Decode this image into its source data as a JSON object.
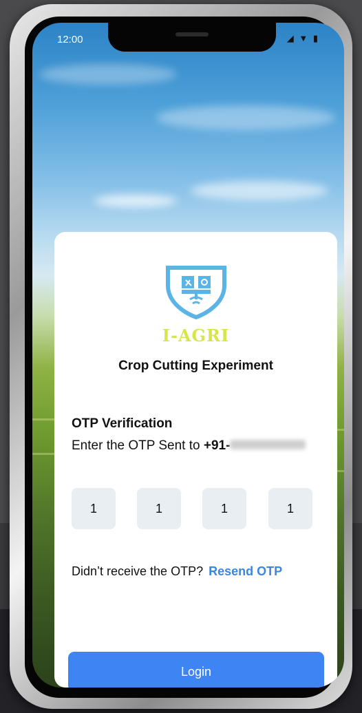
{
  "status_bar": {
    "time": "12:00",
    "icons": "◢ ▼ ▮"
  },
  "logo": {
    "text": "I-AGRI",
    "icon": "shield-logo-icon"
  },
  "app_title": "Crop Cutting Experiment",
  "otp": {
    "heading": "OTP Verification",
    "sent_prefix": "Enter the OTP Sent to ",
    "phone_prefix": "+91-",
    "digits": [
      "1",
      "1",
      "1",
      "1"
    ]
  },
  "resend": {
    "prompt": "Didn’t receive the OTP?",
    "link_label": "Resend OTP"
  },
  "login_label": "Login",
  "colors": {
    "primary": "#3e84f2",
    "link": "#3a86e0",
    "logo_blue": "#5ab4e6",
    "logo_yellow": "#d6e64a",
    "otp_box": "#e9eef3"
  }
}
